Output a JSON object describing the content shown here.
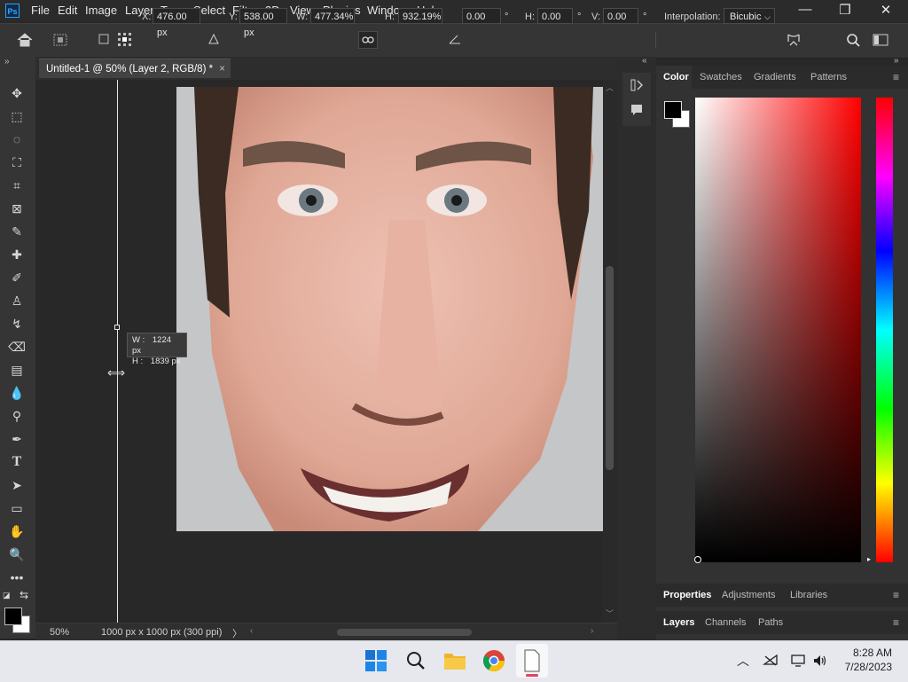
{
  "app": {
    "logo_text": "Ps"
  },
  "menu": [
    "File",
    "Edit",
    "Image",
    "Layer",
    "Type",
    "Select",
    "Filter",
    "3D",
    "View",
    "Plugins",
    "Window",
    "Help"
  ],
  "window_controls": {
    "minimize": "—",
    "restore": "❐",
    "close": "✕"
  },
  "options": {
    "x_label": "X:",
    "x_value": "476.00 px",
    "y_label": "Y:",
    "y_value": "538.00 px",
    "w_label": "W:",
    "w_value": "477.34%",
    "h_label": "H:",
    "h_value": "932.19%",
    "angle_value": "0.00",
    "angle_unit": "°",
    "hskew_label": "H:",
    "hskew_value": "0.00",
    "hskew_unit": "°",
    "vskew_label": "V:",
    "vskew_value": "0.00",
    "vskew_unit": "°",
    "interp_label": "Interpolation:",
    "interp_value": "Bicubic"
  },
  "document": {
    "tab_title": "Untitled-1 @ 50% (Layer 2, RGB/8) *",
    "tab_close": "×"
  },
  "transform_tooltip": {
    "w_label": "W :",
    "w_value": "1224 px",
    "h_label": "H :",
    "h_value": "1839 px"
  },
  "status": {
    "zoom": "50%",
    "doc_info": "1000 px x 1000 px (300 ppi)",
    "arrow": "〉"
  },
  "panels": {
    "color_tabs": [
      "Color",
      "Swatches",
      "Gradients",
      "Patterns"
    ],
    "props_tabs": [
      "Properties",
      "Adjustments",
      "Libraries"
    ],
    "layers_tabs": [
      "Layers",
      "Channels",
      "Paths"
    ]
  },
  "taskbar": {
    "time": "8:28 AM",
    "date": "7/28/2023"
  },
  "colors": {
    "foreground": "#000000",
    "background": "#ffffff",
    "accent": "#31a8ff"
  }
}
